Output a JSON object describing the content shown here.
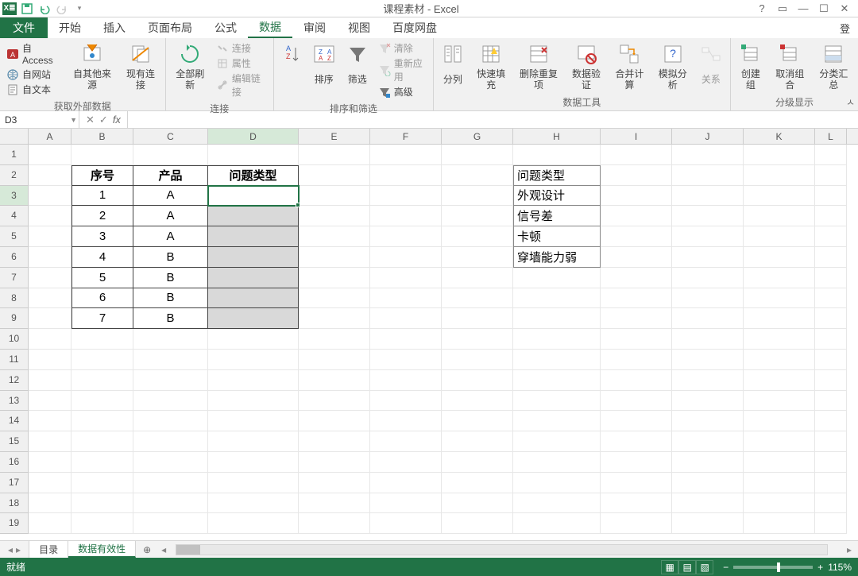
{
  "title": "课程素材 - Excel",
  "signin": "登",
  "qat": {
    "save": "保存",
    "undo": "撤销",
    "redo": "重做"
  },
  "tabs": {
    "file": "文件",
    "home": "开始",
    "insert": "插入",
    "layout": "页面布局",
    "formulas": "公式",
    "data": "数据",
    "review": "审阅",
    "view": "视图",
    "baidu": "百度网盘"
  },
  "ribbon": {
    "g1": {
      "access": "自 Access",
      "web": "自网站",
      "text": "自文本",
      "other": "自其他来源",
      "existing": "现有连接",
      "label": "获取外部数据"
    },
    "g2": {
      "refresh": "全部刷新",
      "conn": "连接",
      "prop": "属性",
      "editlinks": "编辑链接",
      "label": "连接"
    },
    "g3": {
      "sort": "排序",
      "filter": "筛选",
      "clear": "清除",
      "reapply": "重新应用",
      "adv": "高级",
      "label": "排序和筛选"
    },
    "g4": {
      "split": "分列",
      "flash": "快速填充",
      "dedup": "删除重复项",
      "valid": "数据验证",
      "consol": "合并计算",
      "whatif": "模拟分析",
      "rel": "关系",
      "label": "数据工具"
    },
    "g5": {
      "group": "创建组",
      "ungroup": "取消组合",
      "subtotal": "分类汇总",
      "label": "分级显示"
    }
  },
  "namebox": "D3",
  "columns": [
    "A",
    "B",
    "C",
    "D",
    "E",
    "F",
    "G",
    "H",
    "I",
    "J",
    "K",
    "L"
  ],
  "rowcount": 19,
  "table": {
    "headers": {
      "seq": "序号",
      "prod": "产品",
      "type": "问题类型"
    },
    "rows": [
      {
        "seq": "1",
        "prod": "A"
      },
      {
        "seq": "2",
        "prod": "A"
      },
      {
        "seq": "3",
        "prod": "A"
      },
      {
        "seq": "4",
        "prod": "B"
      },
      {
        "seq": "5",
        "prod": "B"
      },
      {
        "seq": "6",
        "prod": "B"
      },
      {
        "seq": "7",
        "prod": "B"
      }
    ]
  },
  "list": [
    "问题类型",
    "外观设计",
    "信号差",
    "卡顿",
    "穿墙能力弱"
  ],
  "sheets": {
    "s1": "目录",
    "s2": "数据有效性"
  },
  "status": {
    "ready": "就绪",
    "zoom": "115%"
  }
}
